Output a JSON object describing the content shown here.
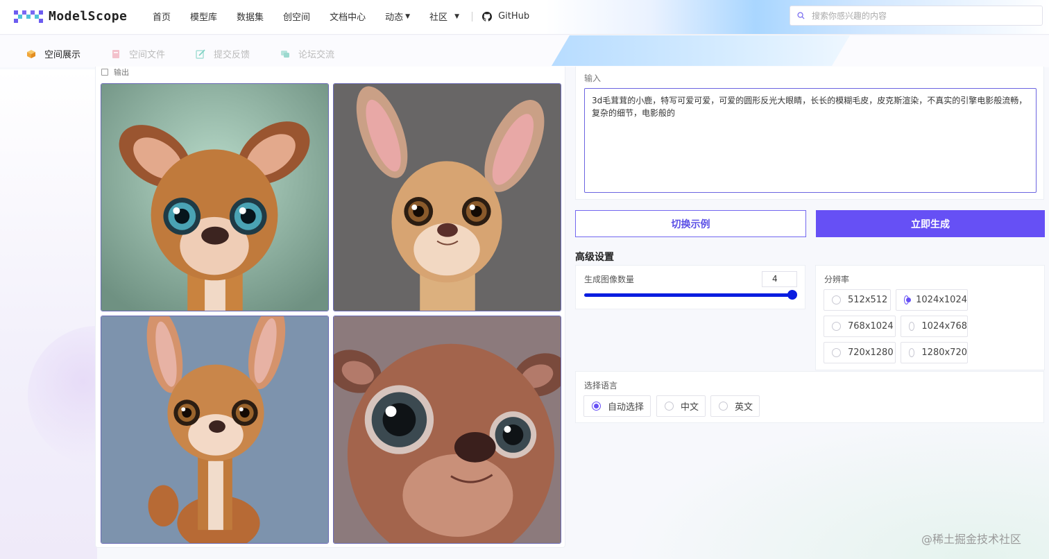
{
  "brand": {
    "logo_text": "ModelScope"
  },
  "nav": {
    "items": [
      {
        "label": "首页",
        "dropdown": false
      },
      {
        "label": "模型库",
        "dropdown": false
      },
      {
        "label": "数据集",
        "dropdown": false
      },
      {
        "label": "创空间",
        "dropdown": false
      },
      {
        "label": "文档中心",
        "dropdown": false
      },
      {
        "label": "动态",
        "dropdown": true
      },
      {
        "label": "社区",
        "dropdown": true
      }
    ],
    "github_label": "GitHub"
  },
  "search": {
    "placeholder": "搜索你感兴趣的内容"
  },
  "subtabs": [
    {
      "label": "空间展示",
      "active": true,
      "icon": "cube-icon"
    },
    {
      "label": "空间文件",
      "active": false,
      "icon": "file-icon"
    },
    {
      "label": "提交反馈",
      "active": false,
      "icon": "edit-icon"
    },
    {
      "label": "论坛交流",
      "active": false,
      "icon": "chat-icon"
    }
  ],
  "output": {
    "label": "输出",
    "images": [
      {
        "subject": "deer-portrait-teal-background"
      },
      {
        "subject": "deer-portrait-gray-background"
      },
      {
        "subject": "deer-fullbody-blue-background"
      },
      {
        "subject": "furry-creature-big-eyes"
      }
    ]
  },
  "input": {
    "label": "输入",
    "prompt": "3d毛茸茸的小鹿，特写可爱可爱，可爱的圆形反光大眼睛，长长的模糊毛皮，皮克斯渲染，不真实的引擎电影般流畅，复杂的细节，电影般的"
  },
  "buttons": {
    "switch_example": "切换示例",
    "generate": "立即生成"
  },
  "advanced": {
    "title": "高级设置",
    "image_count": {
      "label": "生成图像数量",
      "value": "4",
      "slider_fraction": 1.0
    },
    "resolution": {
      "label": "分辨率",
      "options": [
        "512x512",
        "1024x1024",
        "768x1024",
        "1024x768",
        "720x1280",
        "1280x720"
      ],
      "selected": "1024x1024"
    },
    "language": {
      "label": "选择语言",
      "options": [
        "自动选择",
        "中文",
        "英文"
      ],
      "selected": "自动选择"
    }
  },
  "watermark": "@稀土掘金技术社区",
  "colors": {
    "accent": "#6650f5",
    "slider": "#0a1de0",
    "border_focus": "#6b64e0"
  }
}
